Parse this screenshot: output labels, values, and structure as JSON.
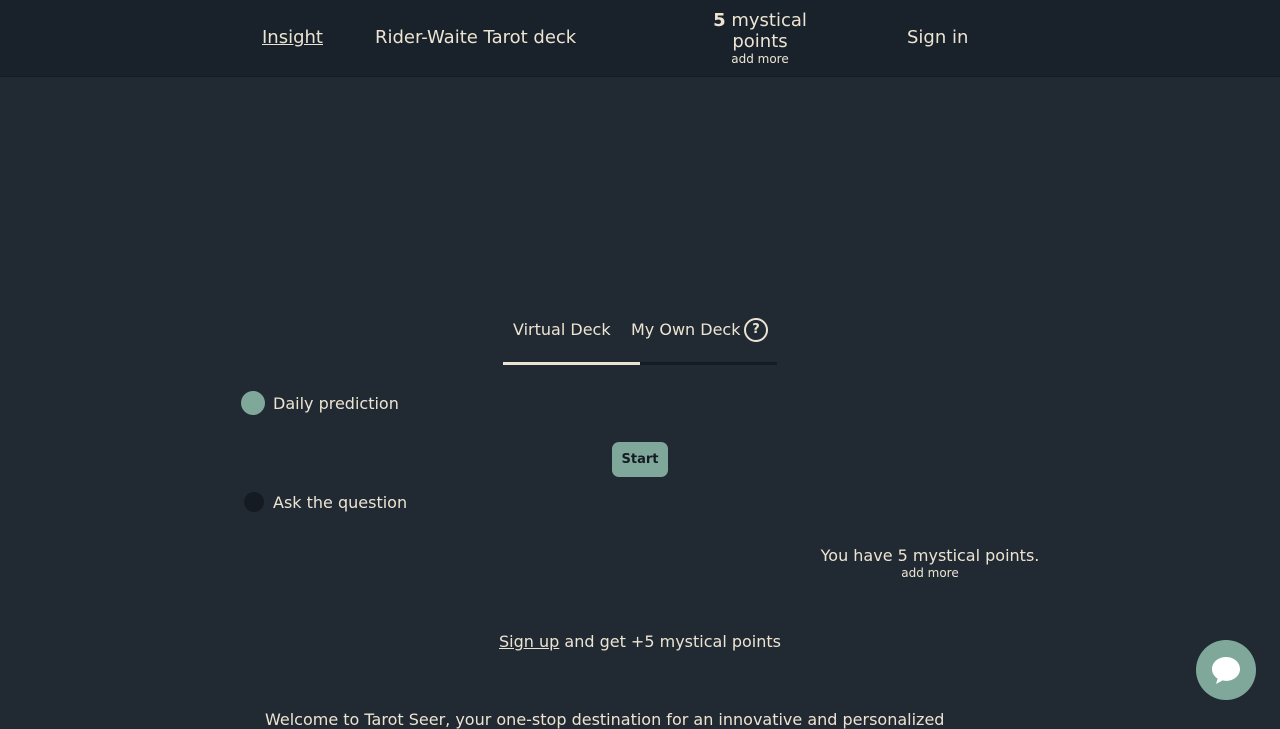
{
  "nav": {
    "insight": "Insight",
    "deck": "Rider-Waite Tarot deck",
    "points_count": "5",
    "points_label": "mystical",
    "points_label2": "points",
    "add_more": "add more",
    "sign_in": "Sign in"
  },
  "tabs": {
    "virtual": "Virtual Deck",
    "own": "My Own Deck",
    "help": "?",
    "active_fraction": 0.5
  },
  "options": {
    "daily": "Daily prediction",
    "ask": "Ask the question",
    "start": "Start"
  },
  "points_info": {
    "text": "You have 5 mystical points.",
    "add_more": "add more"
  },
  "signup": {
    "link": "Sign up",
    "rest": " and get +5 mystical points"
  },
  "welcome": {
    "text": "Welcome to Tarot Seer, your one-stop destination for an innovative and personalized"
  },
  "colors": {
    "accent": "#7fa89b",
    "background": "#212932",
    "text": "#ece4d2"
  },
  "icons": {
    "chat": "chat-bubble-icon",
    "help": "question-circle-icon"
  }
}
